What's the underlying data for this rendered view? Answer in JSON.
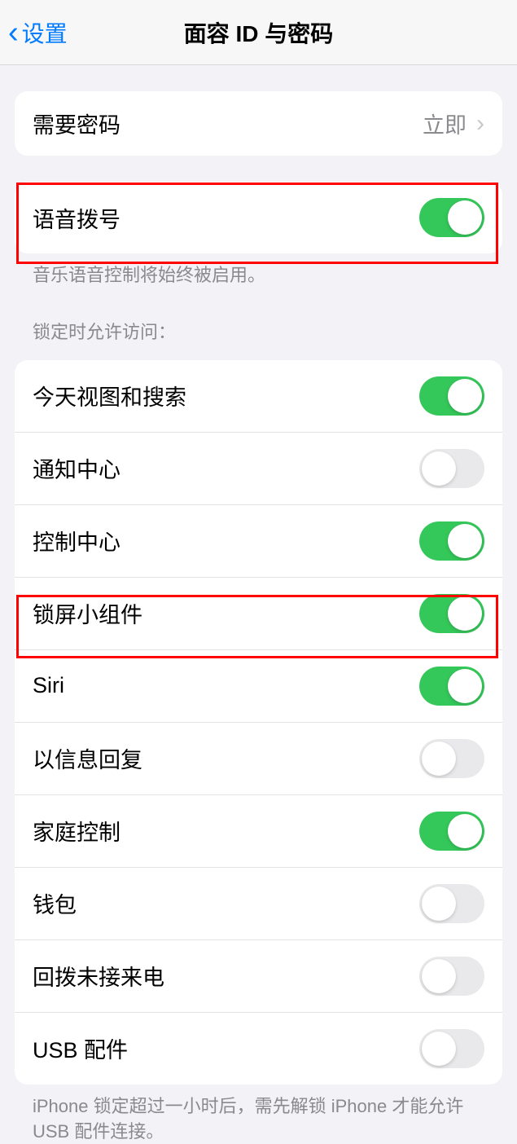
{
  "header": {
    "back_label": "设置",
    "title": "面容 ID 与密码"
  },
  "require_passcode": {
    "label": "需要密码",
    "value": "立即"
  },
  "voice_dial": {
    "label": "语音拨号",
    "on": true,
    "footnote": "音乐语音控制将始终被启用。"
  },
  "lock_access": {
    "header": "锁定时允许访问：",
    "items": [
      {
        "label": "今天视图和搜索",
        "on": true
      },
      {
        "label": "通知中心",
        "on": false
      },
      {
        "label": "控制中心",
        "on": true
      },
      {
        "label": "锁屏小组件",
        "on": true
      },
      {
        "label": "Siri",
        "on": true
      },
      {
        "label": "以信息回复",
        "on": false
      },
      {
        "label": "家庭控制",
        "on": true
      },
      {
        "label": "钱包",
        "on": false
      },
      {
        "label": "回拨未接来电",
        "on": false
      },
      {
        "label": "USB 配件",
        "on": false
      }
    ],
    "footnote": "iPhone 锁定超过一小时后，需先解锁 iPhone 才能允许 USB 配件连接。"
  }
}
